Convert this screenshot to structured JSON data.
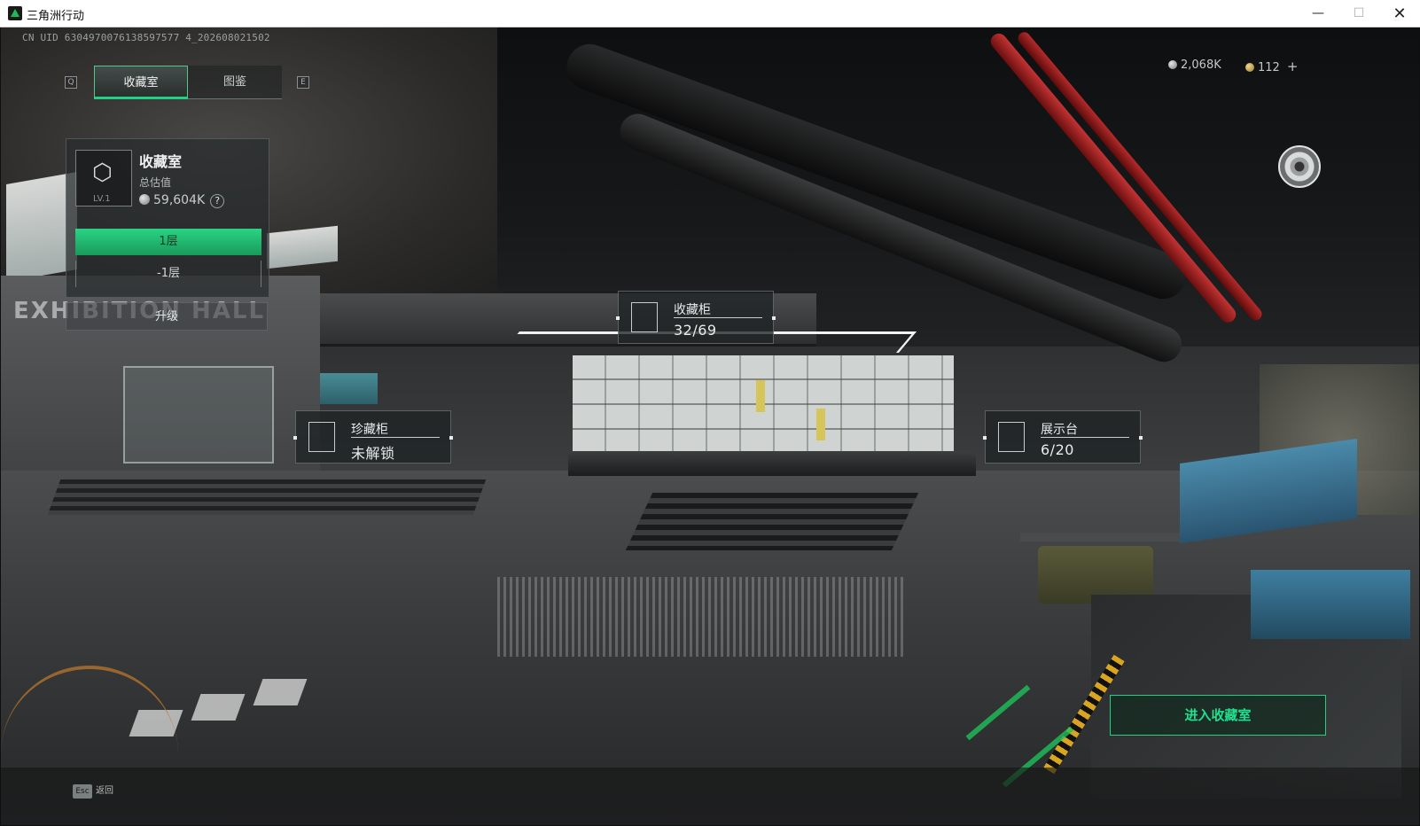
{
  "window": {
    "title": "三角洲行动",
    "min_glyph": "—",
    "max_glyph": "☐",
    "close_glyph": "✕"
  },
  "uid": "CN UID 6304970076138597577 4_202608021502",
  "hotkeys": {
    "prev_tab": "Q",
    "next_tab": "E"
  },
  "tabs": [
    {
      "label": "收藏室",
      "active": true
    },
    {
      "label": "图鉴",
      "active": false
    }
  ],
  "currencies": [
    {
      "icon": "silver-coin-icon",
      "value": "2,068K"
    },
    {
      "icon": "gold-coin-icon",
      "value": "112"
    }
  ],
  "currency_add": "+",
  "room_card": {
    "title": "收藏室",
    "level": "LV.1",
    "value_label": "总估值",
    "value": "59,604K",
    "help": "?",
    "floors": [
      "1层",
      "-1层"
    ],
    "active_floor": 0
  },
  "upgrade_label": "升级",
  "scene_sign": "EXHIBITION HALL",
  "hotspots": {
    "cabinet": {
      "title": "收藏柜",
      "value": "32/69"
    },
    "treasure": {
      "title": "珍藏柜",
      "value": "未解锁"
    },
    "display": {
      "title": "展示台",
      "value": "6/20"
    }
  },
  "enter_button": "进入收藏室",
  "esc": {
    "key": "Esc",
    "label": "返回"
  },
  "colors": {
    "accent_green": "#1fd184",
    "bg": "#0d0f10"
  }
}
